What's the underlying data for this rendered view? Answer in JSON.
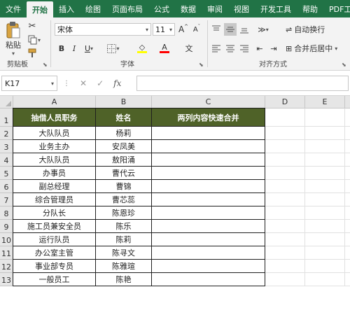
{
  "ribbon_tabs": [
    "文件",
    "开始",
    "插入",
    "绘图",
    "页面布局",
    "公式",
    "数据",
    "审阅",
    "视图",
    "开发工具",
    "帮助",
    "PDF工具集"
  ],
  "active_tab_index": 1,
  "clipboard": {
    "paste_label": "粘贴",
    "group_label": "剪贴板"
  },
  "font": {
    "name": "宋体",
    "size": "11",
    "group_label": "字体",
    "bold": "B",
    "italic": "I",
    "underline": "U",
    "grow": "A",
    "shrink": "A",
    "highlight_color": "#ffff00",
    "font_color": "#ff0000"
  },
  "alignment": {
    "wrap_label": "自动换行",
    "merge_label": "合并后居中",
    "group_label": "对齐方式"
  },
  "formula_bar": {
    "name_box": "K17",
    "fx": "fx",
    "formula": ""
  },
  "columns": [
    "A",
    "B",
    "C",
    "D",
    "E",
    "F"
  ],
  "rows": [
    "1",
    "2",
    "3",
    "4",
    "5",
    "6",
    "7",
    "8",
    "9",
    "10",
    "11",
    "12",
    "13"
  ],
  "table": {
    "headers": [
      "抽借人员职务",
      "姓名",
      "两列内容快速合并"
    ],
    "header_color": "#4f6228",
    "rows": [
      [
        "大队队员",
        "杨莉",
        ""
      ],
      [
        "业务主办",
        "安凤美",
        ""
      ],
      [
        "大队队员",
        "敖阳涌",
        ""
      ],
      [
        "办事员",
        "曹代云",
        ""
      ],
      [
        "副总经理",
        "曹锦",
        ""
      ],
      [
        "综合管理员",
        "曹芯蕊",
        ""
      ],
      [
        "分队长",
        "陈恩珍",
        ""
      ],
      [
        "施工员兼安全员",
        "陈乐",
        ""
      ],
      [
        "运行队员",
        "陈莉",
        ""
      ],
      [
        "办公室主管",
        "陈寻文",
        ""
      ],
      [
        "事业部专员",
        "陈雅瑄",
        ""
      ],
      [
        "一般员工",
        "陈艳",
        ""
      ]
    ]
  }
}
